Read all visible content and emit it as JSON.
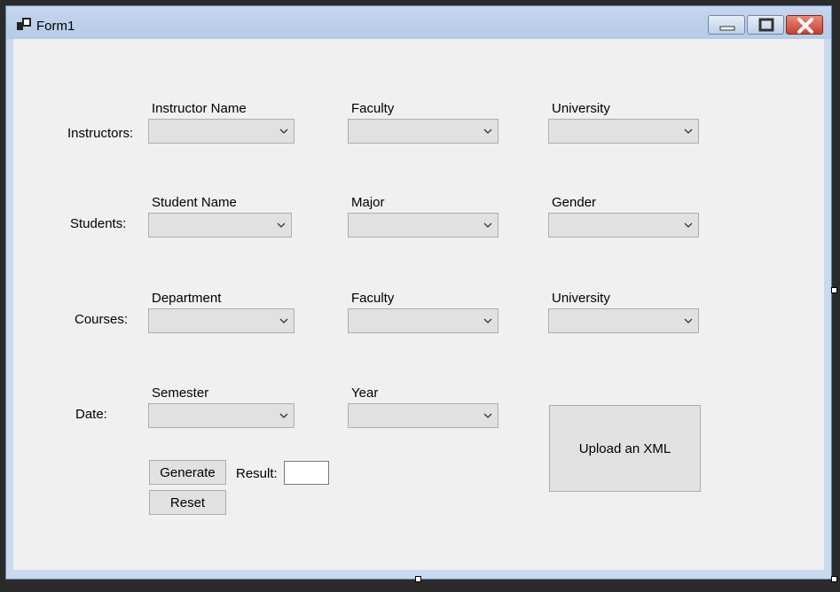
{
  "window": {
    "title": "Form1"
  },
  "rows": [
    {
      "row_label": "Instructors:",
      "fields": [
        {
          "label": "Instructor Name",
          "value": ""
        },
        {
          "label": "Faculty",
          "value": ""
        },
        {
          "label": "University",
          "value": ""
        }
      ]
    },
    {
      "row_label": "Students:",
      "fields": [
        {
          "label": "Student Name",
          "value": ""
        },
        {
          "label": "Major",
          "value": ""
        },
        {
          "label": "Gender",
          "value": ""
        }
      ]
    },
    {
      "row_label": "Courses:",
      "fields": [
        {
          "label": "Department",
          "value": ""
        },
        {
          "label": "Faculty",
          "value": ""
        },
        {
          "label": "University",
          "value": ""
        }
      ]
    },
    {
      "row_label": "Date:",
      "fields": [
        {
          "label": "Semester",
          "value": ""
        },
        {
          "label": "Year",
          "value": ""
        }
      ]
    }
  ],
  "actions": {
    "generate_label": "Generate",
    "reset_label": "Reset",
    "result_label": "Result:",
    "result_value": "",
    "upload_label": "Upload an XML"
  },
  "icons": {
    "app": "form-icon",
    "minimize": "minimize-icon",
    "maximize": "maximize-icon",
    "close": "close-icon",
    "dropdown": "chevron-down-icon"
  },
  "colors": {
    "close_button": "#c7402c",
    "client_bg": "#f0f0f0",
    "titlebar": "#b6cbe6"
  }
}
